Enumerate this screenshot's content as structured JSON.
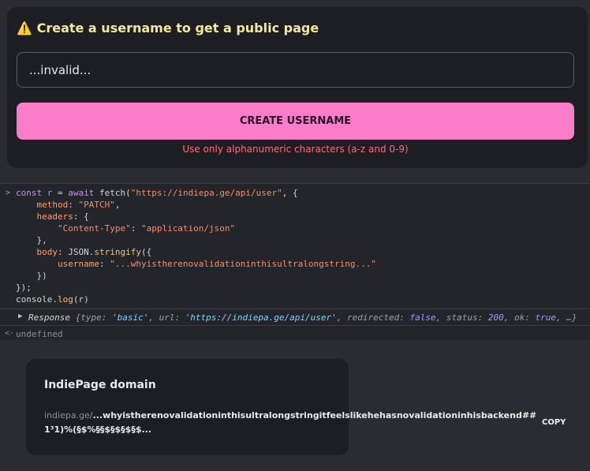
{
  "alert": {
    "icon": "warning-icon",
    "title": "Create a username to get a public page"
  },
  "form": {
    "input_value": "...invalid...",
    "button_label": "CREATE USERNAME",
    "error": "Use only alphanumeric characters (a-z and 0-9)"
  },
  "console": {
    "code_lines": [
      "const r = await fetch(\"https://indiepa.ge/api/user\", {",
      "    method: \"PATCH\",",
      "    headers: {",
      "        \"Content-Type\": \"application/json\"",
      "    },",
      "    body: JSON.stringify({",
      "        username: \"...whyistherenovalidationinthisultralongstring...\"",
      "    })",
      "});",
      "console.log(r)"
    ],
    "response": {
      "label": "Response",
      "type": "'basic'",
      "url": "'https://indiepa.ge/api/user'",
      "redirected": "false",
      "status": "200",
      "ok": "true"
    },
    "return_value": "undefined"
  },
  "domain": {
    "title": "IndiePage domain",
    "prefix": "indiepa.ge/",
    "username": "...whyistherenovalidationinthisultralongstringitfeelslikehehasnovalidationinhisbackend##1³1)%(§$%§§$§$§$§$...",
    "copy_label": "COPY"
  },
  "colors": {
    "accent": "#fb7cc8",
    "warning": "#f4e8a0",
    "error": "#ff6b7d"
  }
}
